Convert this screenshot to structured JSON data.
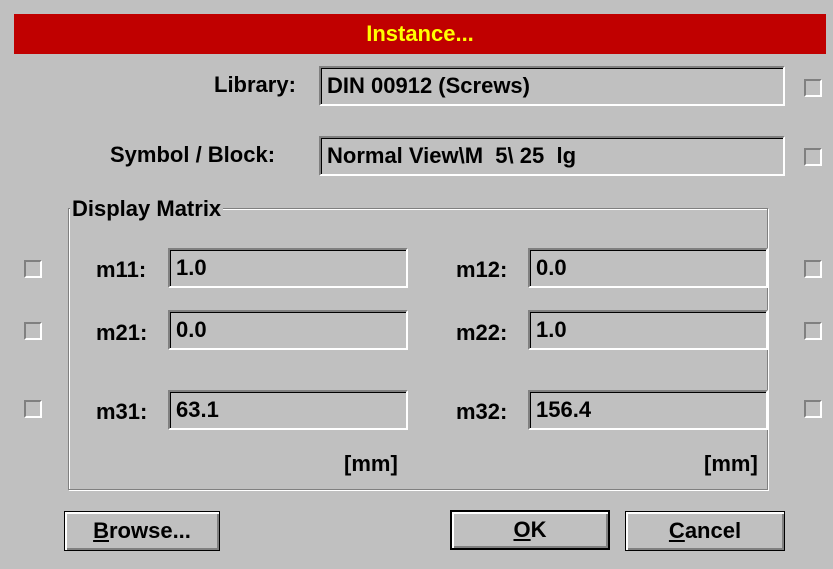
{
  "dialog": {
    "title": "Instance..."
  },
  "library": {
    "label": "Library:",
    "value": "DIN 00912 (Screws)"
  },
  "symbol": {
    "label": "Symbol / Block:",
    "value": "Normal View\\M  5\\ 25  lg"
  },
  "matrix": {
    "group_label": "Display Matrix",
    "m11": {
      "label": "m11:",
      "value": "1.0"
    },
    "m12": {
      "label": "m12:",
      "value": "0.0"
    },
    "m21": {
      "label": "m21:",
      "value": "0.0"
    },
    "m22": {
      "label": "m22:",
      "value": "1.0"
    },
    "m31": {
      "label": "m31:",
      "value": "63.1"
    },
    "m32": {
      "label": "m32:",
      "value": "156.4"
    },
    "unit_left": "[mm]",
    "unit_right": "[mm]"
  },
  "buttons": {
    "browse": {
      "mnemonic": "B",
      "rest": "rowse..."
    },
    "ok": {
      "mnemonic": "O",
      "rest": "K"
    },
    "cancel": {
      "mnemonic": "C",
      "rest": "ancel"
    }
  }
}
